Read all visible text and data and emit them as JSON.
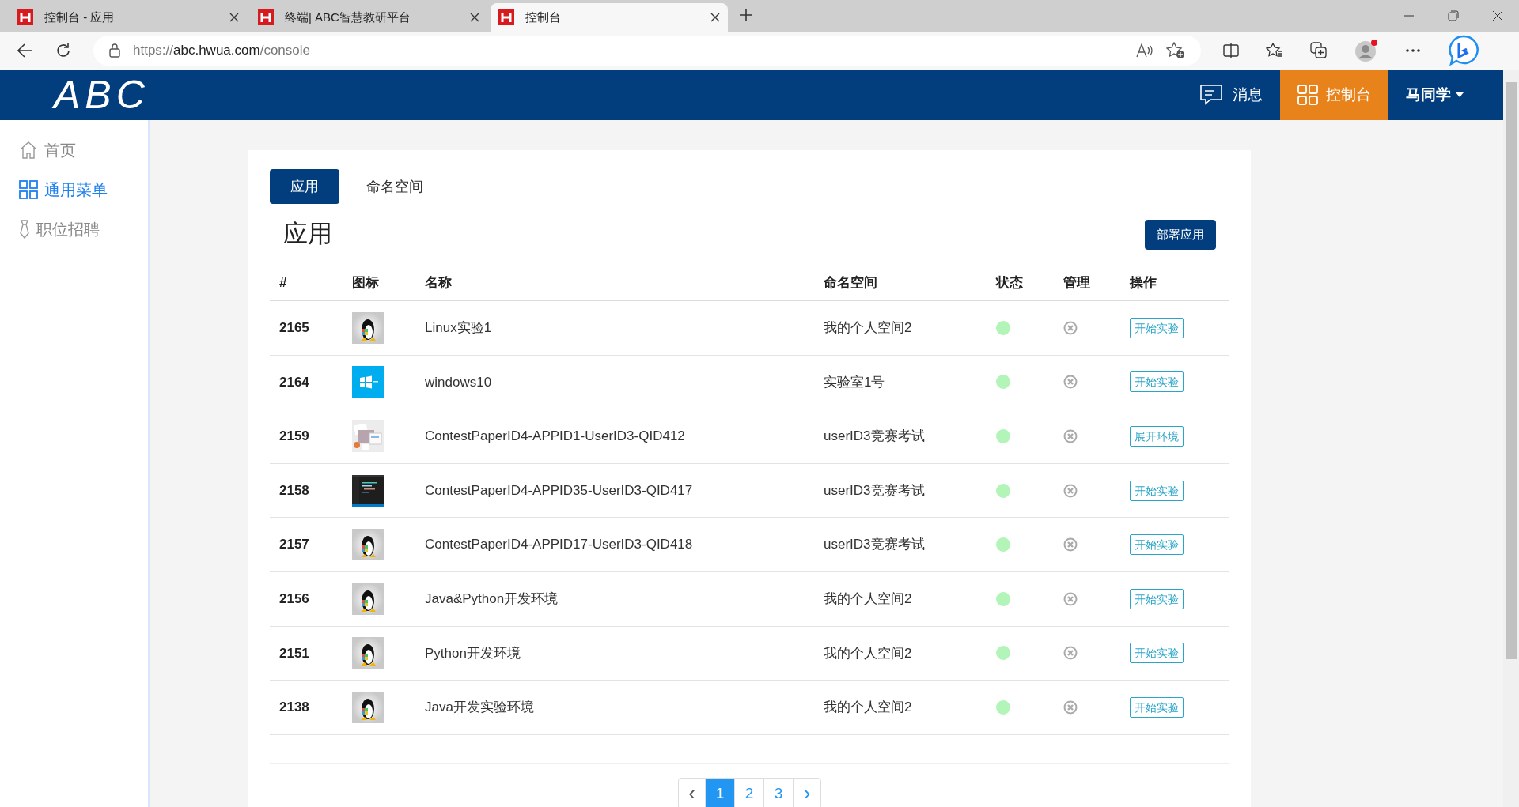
{
  "browser": {
    "tabs": [
      {
        "title": "控制台 - 应用",
        "selected": false
      },
      {
        "title": "终端| ABC智慧教研平台",
        "selected": false
      },
      {
        "title": "控制台",
        "selected": true
      }
    ],
    "address": {
      "origin": "https://",
      "host": "abc.hwua.com",
      "path": "/console"
    }
  },
  "header": {
    "logo": "ABC",
    "nav": [
      {
        "label": "消息",
        "selected": false
      },
      {
        "label": "控制台",
        "selected": true
      }
    ],
    "user": "马同学"
  },
  "sidebar": {
    "items": [
      {
        "label": "首页",
        "kind": "home",
        "selected": false
      },
      {
        "label": "通用菜单",
        "kind": "grid",
        "selected": true
      },
      {
        "label": "职位招聘",
        "kind": "tie",
        "selected": false
      }
    ]
  },
  "content": {
    "tabs": [
      {
        "label": "应用",
        "selected": true
      },
      {
        "label": "命名空间",
        "selected": false
      }
    ],
    "title": "应用",
    "deploy_button": "部署应用",
    "table": {
      "columns": [
        "#",
        "图标",
        "名称",
        "命名空间",
        "状态",
        "管理",
        "操作"
      ],
      "rows": [
        {
          "id": "2165",
          "name": "Linux实验1",
          "namespace": "我的个人空间2",
          "action": "开始实验"
        },
        {
          "id": "2164",
          "name": "windows10",
          "namespace": "实验室1号",
          "action": "开始实验"
        },
        {
          "id": "2159",
          "name": "ContestPaperID4-APPID1-UserID3-QID412",
          "namespace": "userID3竞赛考试",
          "action": "展开环境"
        },
        {
          "id": "2158",
          "name": "ContestPaperID4-APPID35-UserID3-QID417",
          "namespace": "userID3竞赛考试",
          "action": "开始实验"
        },
        {
          "id": "2157",
          "name": "ContestPaperID4-APPID17-UserID3-QID418",
          "namespace": "userID3竞赛考试",
          "action": "开始实验"
        },
        {
          "id": "2156",
          "name": "Java&Python开发环境",
          "namespace": "我的个人空间2",
          "action": "开始实验"
        },
        {
          "id": "2151",
          "name": "Python开发环境",
          "namespace": "我的个人空间2",
          "action": "开始实验"
        },
        {
          "id": "2138",
          "name": "Java开发实验环境",
          "namespace": "我的个人空间2",
          "action": "开始实验"
        }
      ]
    },
    "pagination": {
      "prev": "‹",
      "pages": [
        {
          "label": "1",
          "selected": true
        },
        {
          "label": "2",
          "selected": false
        },
        {
          "label": "3",
          "selected": false
        }
      ],
      "next": "›"
    }
  }
}
